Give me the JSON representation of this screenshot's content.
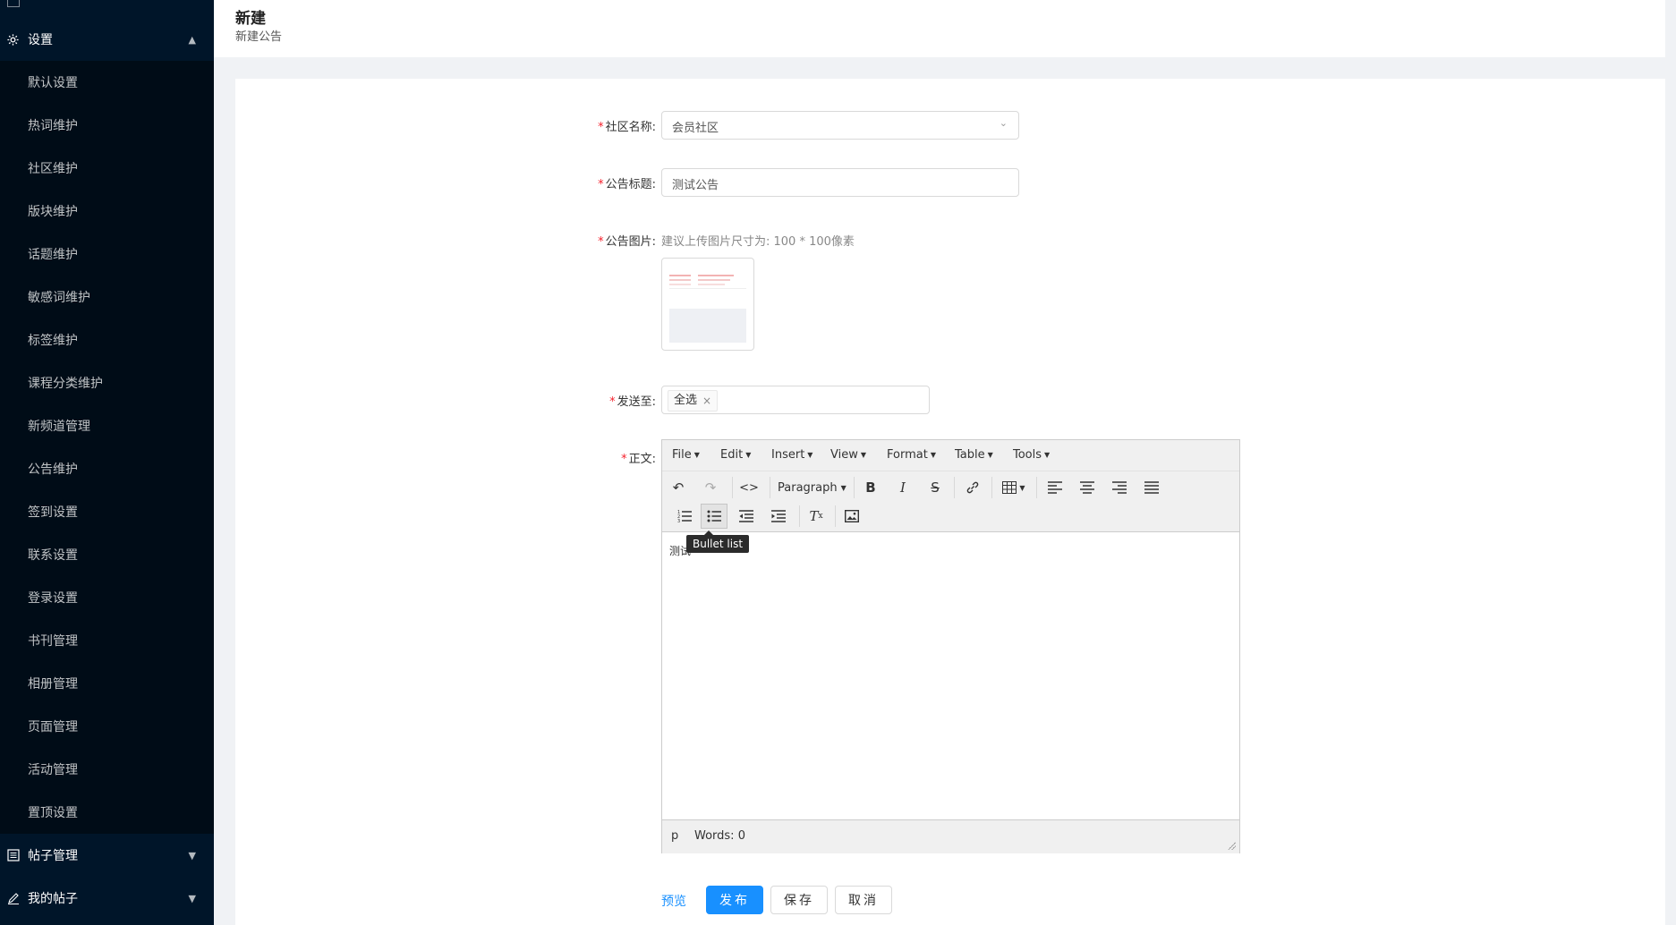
{
  "sidebar": {
    "settings_label": "设置",
    "items": [
      {
        "label": "默认设置"
      },
      {
        "label": "热词维护"
      },
      {
        "label": "社区维护"
      },
      {
        "label": "版块维护"
      },
      {
        "label": "话题维护"
      },
      {
        "label": "敏感词维护"
      },
      {
        "label": "标签维护"
      },
      {
        "label": "课程分类维护"
      },
      {
        "label": "新频道管理"
      },
      {
        "label": "公告维护"
      },
      {
        "label": "签到设置"
      },
      {
        "label": "联系设置"
      },
      {
        "label": "登录设置"
      },
      {
        "label": "书刊管理"
      },
      {
        "label": "相册管理"
      },
      {
        "label": "页面管理"
      },
      {
        "label": "活动管理"
      },
      {
        "label": "置顶设置"
      }
    ],
    "posts_label": "帖子管理",
    "my_posts_label": "我的帖子"
  },
  "header": {
    "title": "新建",
    "subtitle": "新建公告"
  },
  "form": {
    "community_label": "社区名称:",
    "community_value": "会员社区",
    "title_label": "公告标题:",
    "title_value": "测试公告",
    "image_label": "公告图片:",
    "image_hint": "建议上传图片尺寸为: 100 * 100像素",
    "send_label": "发送至:",
    "send_tags": [
      "全选"
    ],
    "body_label": "正文:"
  },
  "editor": {
    "menus": [
      "File",
      "Edit",
      "Insert",
      "View",
      "Format",
      "Table",
      "Tools"
    ],
    "block_format": "Paragraph",
    "content": "测试",
    "tooltip": "Bullet list",
    "status_path": "p",
    "word_count": "Words: 0"
  },
  "actions": {
    "preview": "预览",
    "publish": "发布",
    "save": "保存",
    "cancel": "取消"
  },
  "colors": {
    "sidebar_bg": "#001529",
    "submenu_bg": "#000c17",
    "primary": "#1890ff",
    "required": "#f5222d"
  }
}
